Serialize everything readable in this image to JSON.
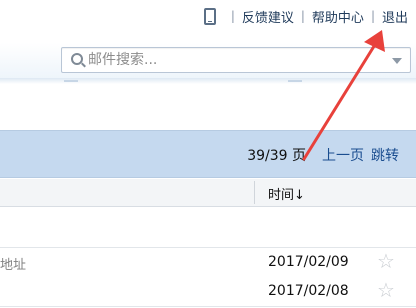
{
  "header": {
    "links": {
      "feedback": "反馈建议",
      "help": "帮助中心",
      "logout": "退出"
    },
    "separator": "|",
    "phone_icon": "mobile-phone-icon"
  },
  "search": {
    "placeholder": "邮件搜索...",
    "icon": "search-icon"
  },
  "toolbar": {
    "page_count": "39/39 页",
    "prev_page": "上一页",
    "jump": "跳转"
  },
  "columns": {
    "time": "时间↓"
  },
  "rows": [
    {
      "subject": "地址",
      "date": "2017/02/09",
      "starred": false
    },
    {
      "subject": "",
      "date": "2017/02/08",
      "starred": false
    }
  ],
  "annotation": {
    "color": "#e8413b",
    "target": "logout-link"
  },
  "colors": {
    "toolbar_bg": "#c5d9ef",
    "link": "#1a4d8f"
  }
}
